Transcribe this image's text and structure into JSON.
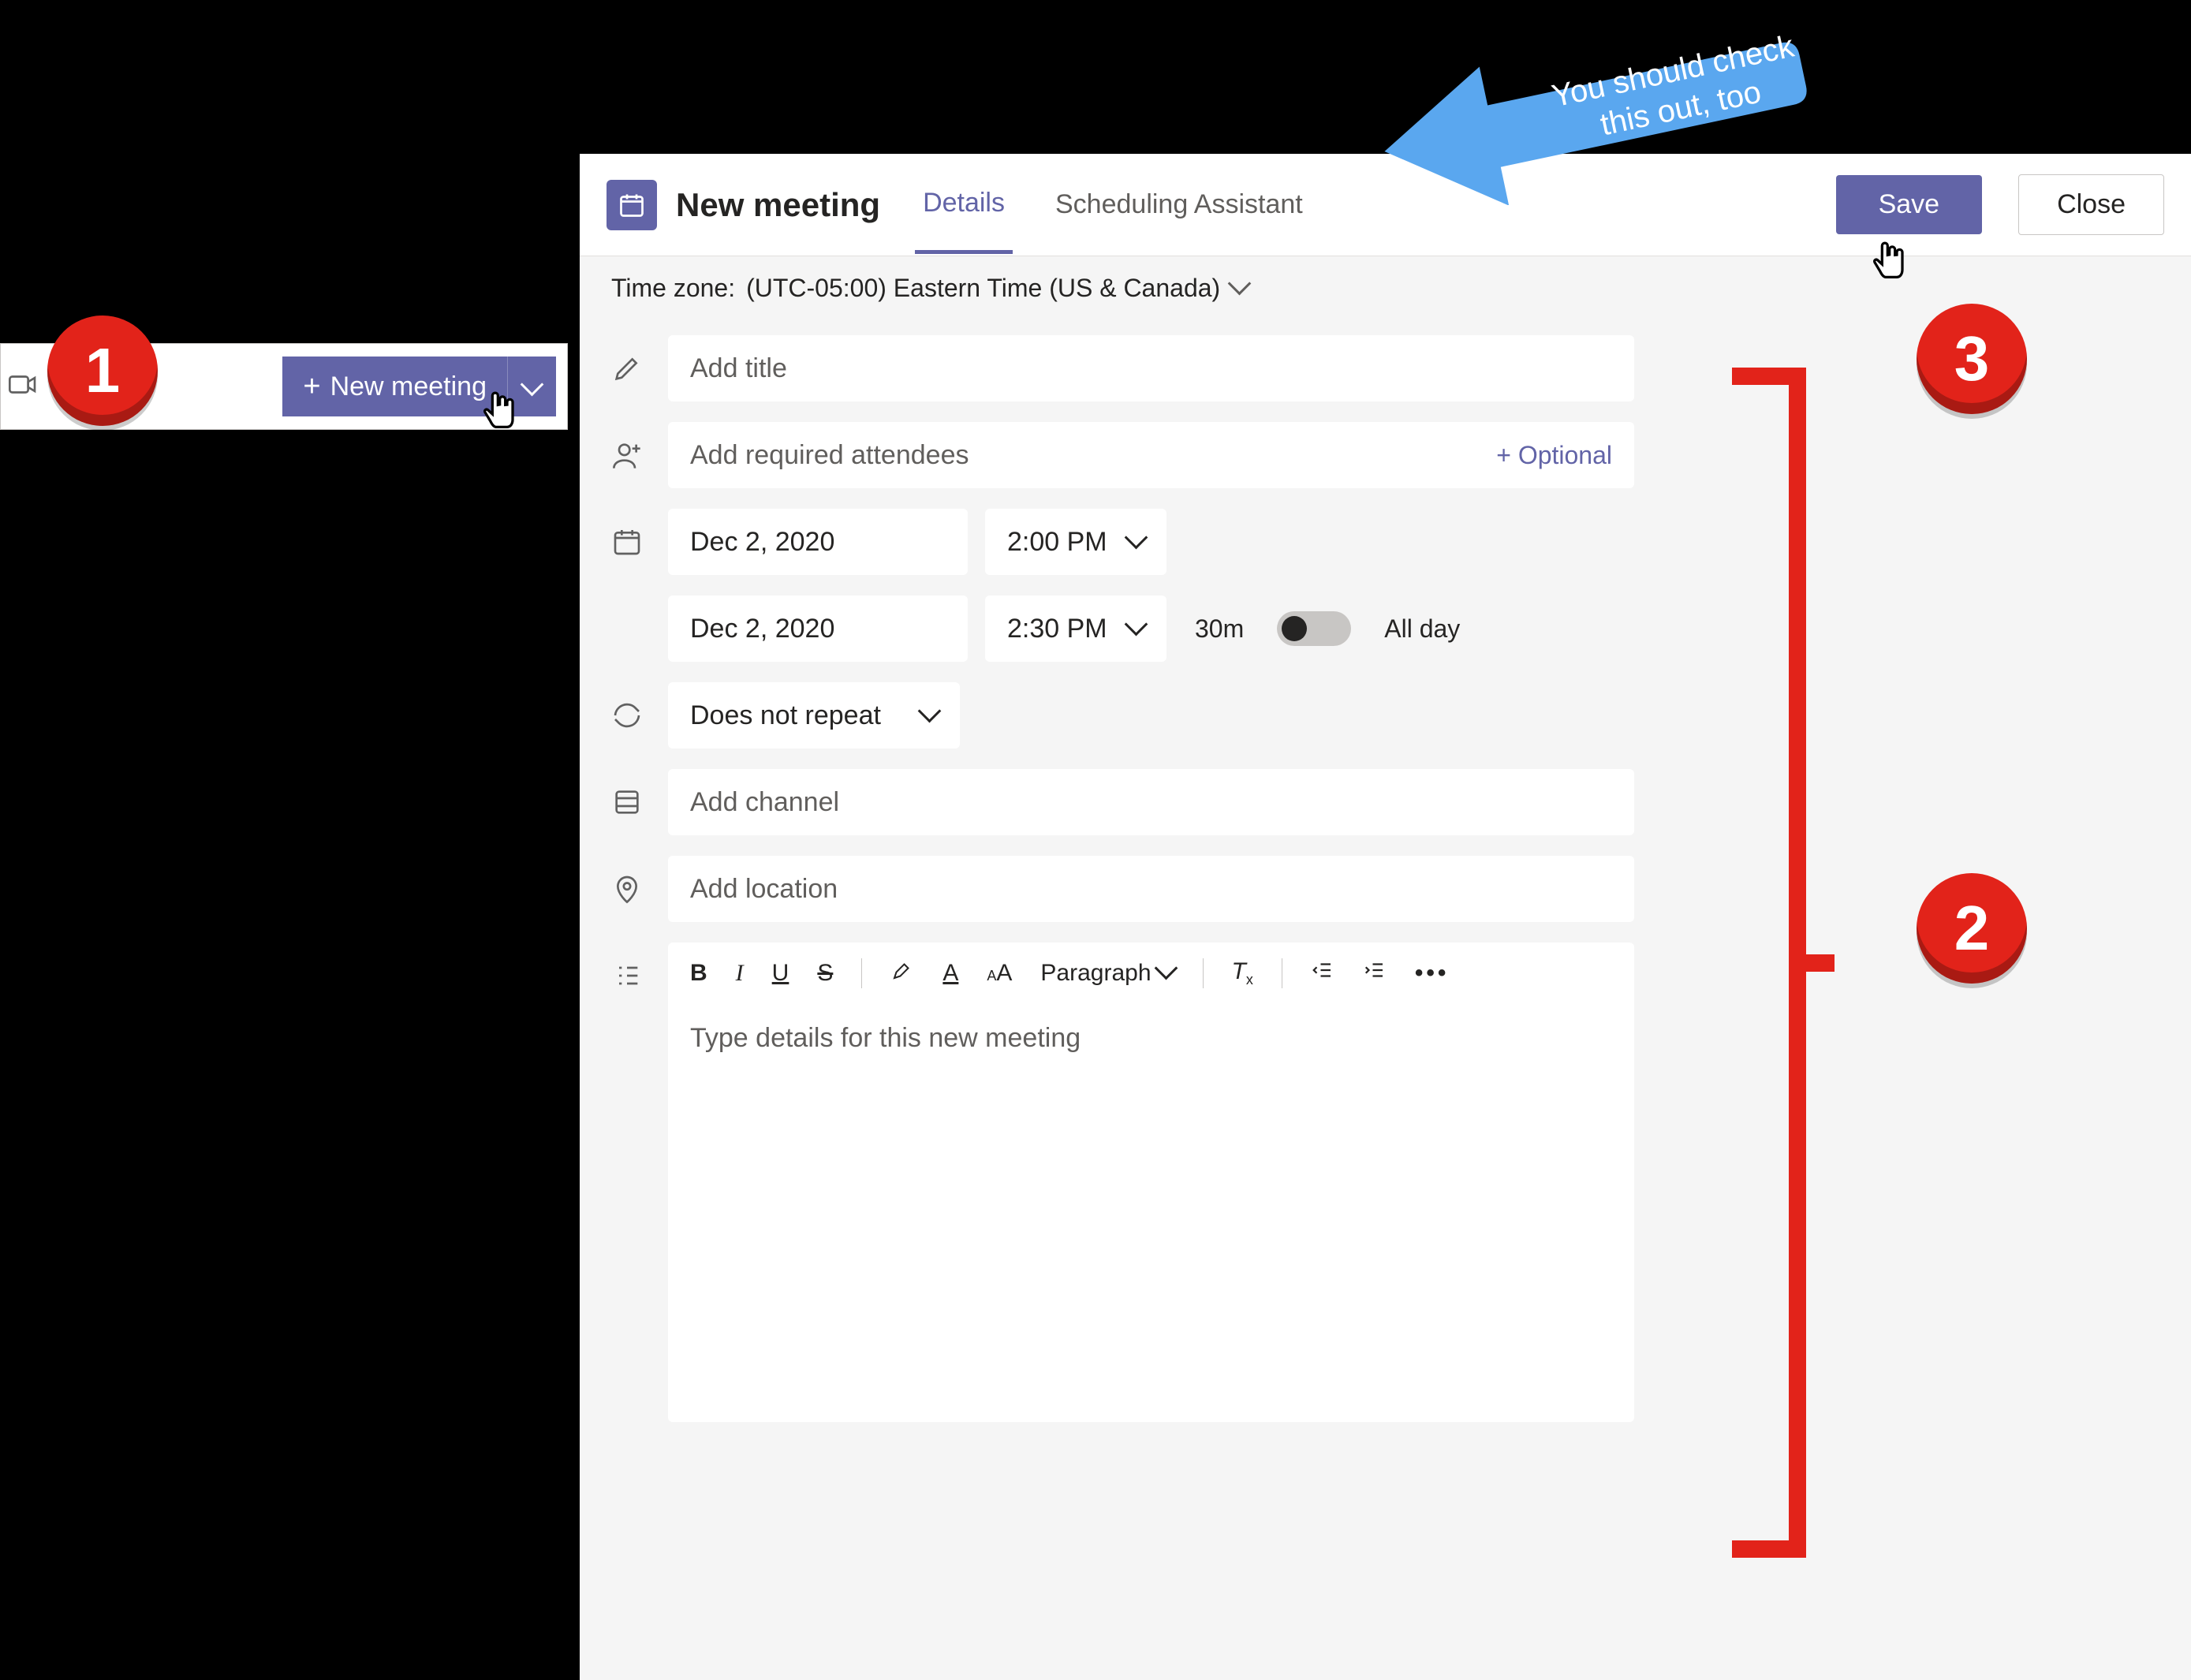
{
  "side_button": {
    "label": "New meeting"
  },
  "header": {
    "title": "New meeting",
    "tab_details": "Details",
    "tab_scheduling": "Scheduling Assistant",
    "save": "Save",
    "close": "Close"
  },
  "timezone": {
    "label": "Time zone:",
    "value": "(UTC-05:00) Eastern Time (US & Canada)"
  },
  "form": {
    "title_placeholder": "Add title",
    "attendees_placeholder": "Add required attendees",
    "optional": "+ Optional",
    "start_date": "Dec 2, 2020",
    "start_time": "2:00 PM",
    "end_date": "Dec 2, 2020",
    "end_time": "2:30 PM",
    "duration": "30m",
    "all_day": "All day",
    "repeat": "Does not repeat",
    "channel_placeholder": "Add channel",
    "location_placeholder": "Add location",
    "paragraph": "Paragraph",
    "details_placeholder": "Type details for this new meeting"
  },
  "callouts": {
    "one": "1",
    "two": "2",
    "three": "3",
    "arrow_text_l1": "You should check",
    "arrow_text_l2": "this out, too"
  }
}
